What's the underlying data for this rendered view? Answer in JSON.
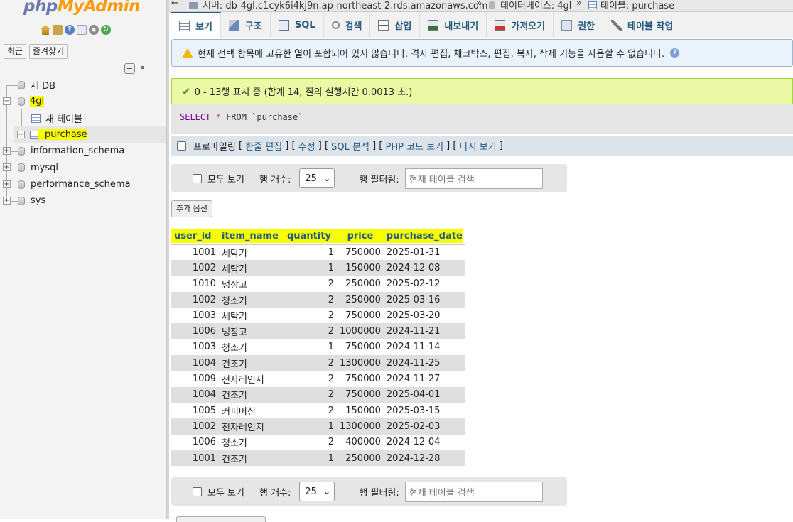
{
  "nav": {
    "logo_part1": "php",
    "logo_part2": "MyAdmin",
    "recent_label": "최근",
    "favorites_label": "즐겨찾기",
    "tree": {
      "new_db": "새 DB",
      "db_4gl": "4gl",
      "new_table": "새 테이블",
      "purchase": "purchase",
      "information_schema": "information_schema",
      "mysql": "mysql",
      "performance_schema": "performance_schema",
      "sys": "sys"
    }
  },
  "breadcrumb": {
    "server": "서버: db-4gl.c1cyk6i4kj9n.ap-northeast-2.rds.amazonaws.com",
    "sep": "»",
    "database": "데이터베이스: 4gl",
    "table": "테이블: purchase"
  },
  "tabs": [
    {
      "label": "보기"
    },
    {
      "label": "구조"
    },
    {
      "label": "SQL"
    },
    {
      "label": "검색"
    },
    {
      "label": "삽입"
    },
    {
      "label": "내보내기"
    },
    {
      "label": "가져오기"
    },
    {
      "label": "권한"
    },
    {
      "label": "테이블 작업"
    }
  ],
  "notice": "현재 선택 항목에 고유한 열이 포함되어 있지 않습니다. 격자 편집, 체크박스, 편집, 복사, 삭제 기능을 사용할 수 없습니다.",
  "success": "0 - 13행 표시 중 (합계 14, 질의 실행시간 0.0013 초.)",
  "sql": {
    "kw1": "SELECT",
    "star": "*",
    "kw2": "FROM",
    "table": "`purchase`"
  },
  "profiling": {
    "label": "프로파일링",
    "inline_edit": "한줄 편집",
    "edit": "수정",
    "sql_analyze": "SQL 분석",
    "php_code": "PHP 코드 보기",
    "refresh": "다시 보기"
  },
  "navbar": {
    "show_all": "모두 보기",
    "rows_label": "행 개수:",
    "rows_value": "25",
    "filter_label": "행 필터링:",
    "filter_placeholder": "현재 테이블 검색"
  },
  "extra_options": "추가 옵션",
  "table": {
    "columns": [
      "user_id",
      "item_name",
      "quantity",
      "price",
      "purchase_date"
    ],
    "rows": [
      [
        "1001",
        "세탁기",
        "1",
        "750000",
        "2025-01-31"
      ],
      [
        "1002",
        "세탁기",
        "1",
        "150000",
        "2024-12-08"
      ],
      [
        "1010",
        "냉장고",
        "2",
        "250000",
        "2025-02-12"
      ],
      [
        "1002",
        "청소기",
        "2",
        "250000",
        "2025-03-16"
      ],
      [
        "1003",
        "세탁기",
        "2",
        "750000",
        "2025-03-20"
      ],
      [
        "1006",
        "냉장고",
        "2",
        "1000000",
        "2024-11-21"
      ],
      [
        "1003",
        "청소기",
        "1",
        "750000",
        "2024-11-14"
      ],
      [
        "1004",
        "건조기",
        "2",
        "1300000",
        "2024-11-25"
      ],
      [
        "1009",
        "전자레인지",
        "2",
        "750000",
        "2024-11-27"
      ],
      [
        "1004",
        "건조기",
        "2",
        "750000",
        "2025-04-01"
      ],
      [
        "1005",
        "커피머신",
        "2",
        "150000",
        "2025-03-15"
      ],
      [
        "1002",
        "전자레인지",
        "1",
        "1300000",
        "2025-02-03"
      ],
      [
        "1006",
        "청소기",
        "2",
        "400000",
        "2024-12-04"
      ],
      [
        "1001",
        "건조기",
        "1",
        "250000",
        "2024-12-28"
      ]
    ]
  },
  "colors": {
    "link": "#235a81",
    "highlight": "#f8ff00",
    "success_bg": "#ebf8a4"
  }
}
